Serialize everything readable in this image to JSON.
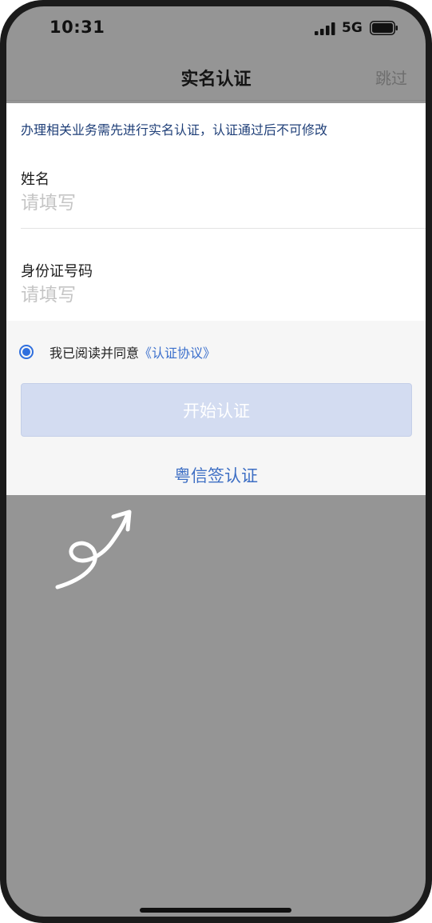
{
  "status_bar": {
    "time": "10:31",
    "network": "5G",
    "icons": [
      "signal-icon",
      "battery-icon"
    ]
  },
  "nav": {
    "title": "实名认证",
    "skip_label": "跳过"
  },
  "form": {
    "notice": "办理相关业务需先进行实名认证，认证通过后不可修改",
    "name_label": "姓名",
    "name_placeholder": "请填写",
    "name_value": "",
    "id_label": "身份证号码",
    "id_placeholder": "请填写",
    "id_value": ""
  },
  "agreement": {
    "checked": true,
    "text": "我已阅读并同意",
    "link": "《认证协议》"
  },
  "actions": {
    "start_label": "开始认证",
    "alt_label": "粤信签认证"
  },
  "colors": {
    "accent": "#2f6fde",
    "link": "#3e6fc4",
    "button_disabled": "#d3dcf1",
    "overlay": "#959595"
  }
}
